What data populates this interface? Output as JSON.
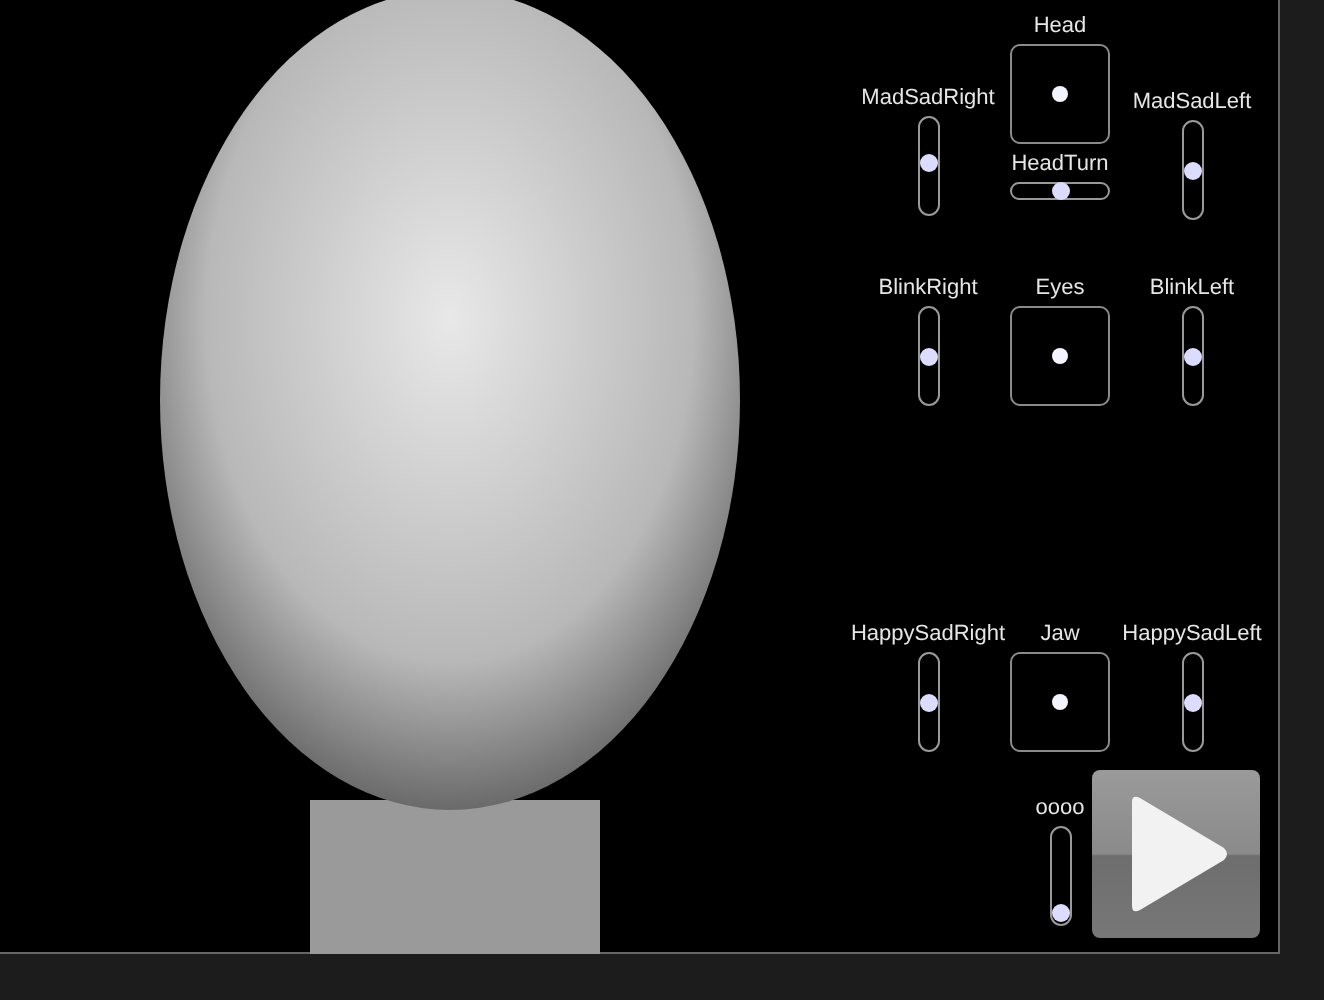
{
  "controls": {
    "rows": [
      {
        "left": {
          "label": "MadSadRight",
          "level": 0.54
        },
        "pad": {
          "label": "Head"
        },
        "turn": {
          "label": "HeadTurn",
          "level": 0.5
        },
        "right": {
          "label": "MadSadLeft",
          "level": 0.5
        }
      },
      {
        "left": {
          "label": "BlinkRight",
          "level": 0.5
        },
        "pad": {
          "label": "Eyes"
        },
        "right": {
          "label": "BlinkLeft",
          "level": 0.5
        }
      },
      {
        "left": {
          "label": "HappySadRight",
          "level": 0.5
        },
        "pad": {
          "label": "Jaw"
        },
        "right": {
          "label": "HappySadLeft",
          "level": 0.5
        }
      }
    ],
    "extra": {
      "label": "oooo",
      "level": 0.02
    }
  }
}
